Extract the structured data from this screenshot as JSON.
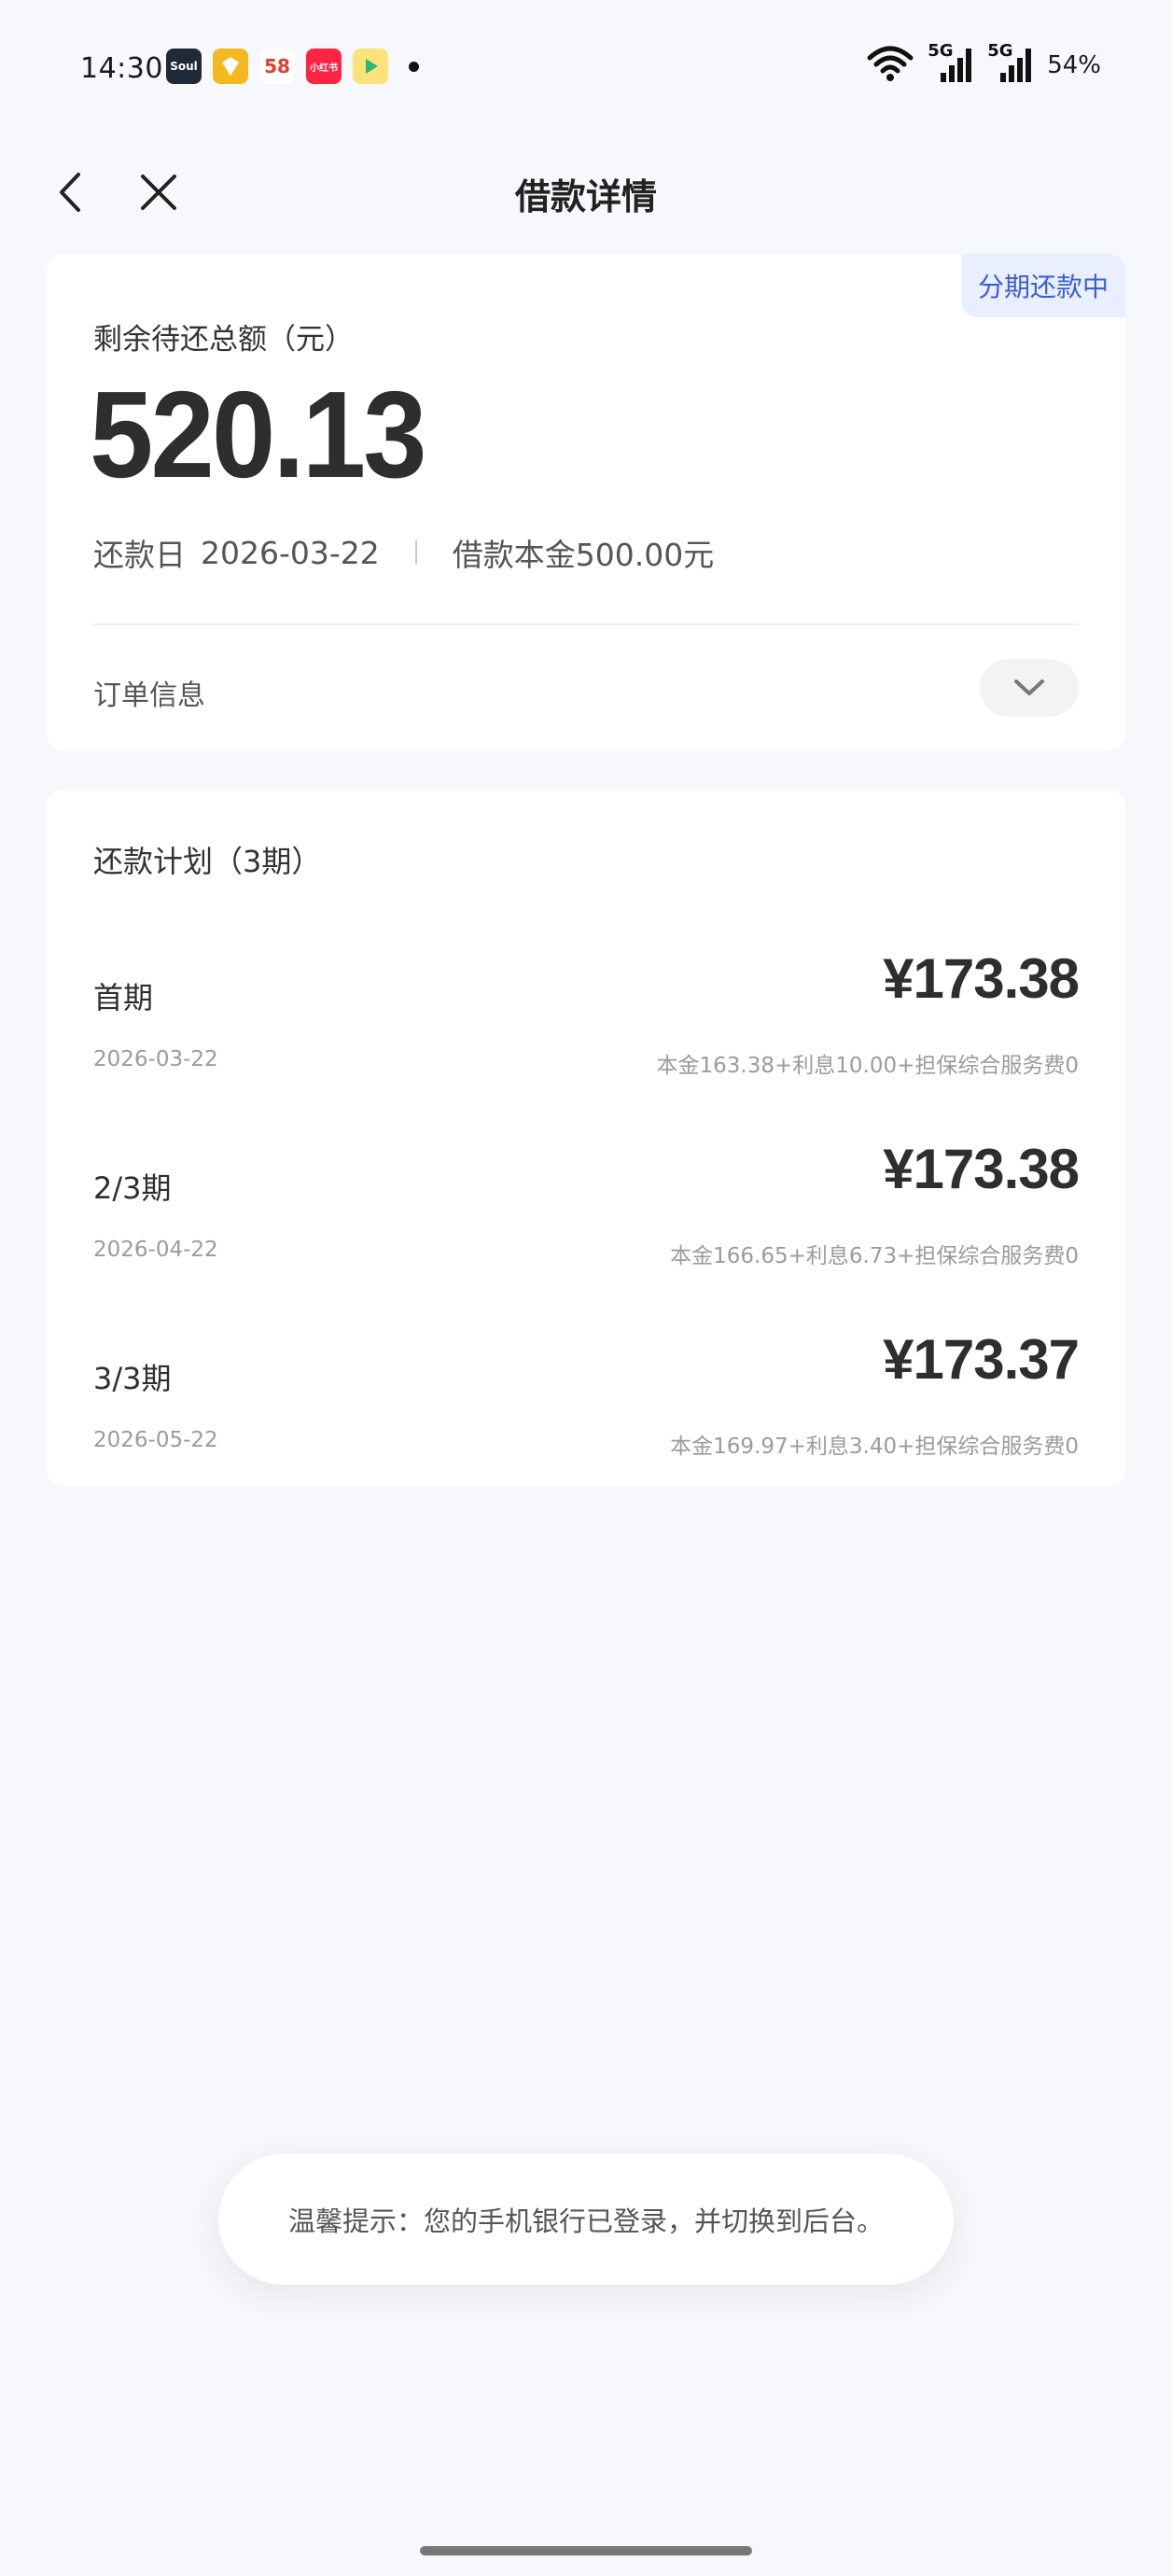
{
  "status_bar": {
    "time": "14:30",
    "apps": [
      {
        "name": "soul-app-icon",
        "label": "Soul"
      },
      {
        "name": "yellow-app-icon",
        "label": ""
      },
      {
        "name": "58-app-icon",
        "label": "58"
      },
      {
        "name": "xiaohongshu-app-icon",
        "label": "小红书"
      },
      {
        "name": "video-app-icon",
        "label": ""
      }
    ],
    "network_1": "5G",
    "network_2": "5G",
    "battery": "54%"
  },
  "nav": {
    "title": "借款详情",
    "back_icon": "chevron-left-icon",
    "close_icon": "close-icon"
  },
  "summary": {
    "status_tag": "分期还款中",
    "label": "剩余待还总额（元）",
    "amount": "520.13",
    "due_label": "还款日",
    "due_date": "2026-03-22",
    "principal_text": "借款本金500.00元",
    "order_info_label": "订单信息",
    "toggle_icon": "chevron-down-icon"
  },
  "plan": {
    "title": "还款计划（3期）",
    "periods": [
      {
        "label": "首期",
        "amount": "¥173.38",
        "date": "2026-03-22",
        "breakdown": "本金163.38+利息10.00+担保综合服务费0"
      },
      {
        "label": "2/3期",
        "amount": "¥173.38",
        "date": "2026-04-22",
        "breakdown": "本金166.65+利息6.73+担保综合服务费0"
      },
      {
        "label": "3/3期",
        "amount": "¥173.37",
        "date": "2026-05-22",
        "breakdown": "本金169.97+利息3.40+担保综合服务费0"
      }
    ]
  },
  "toast": {
    "text": "温馨提示：您的手机银行已登录，并切换到后台。"
  },
  "colors": {
    "background": "#f7f8fc",
    "card": "#ffffff",
    "accent": "#3a5fd0",
    "tag_bg": "#e9efff",
    "text_primary": "#2e2e2e",
    "text_secondary": "#9b9b9b"
  }
}
